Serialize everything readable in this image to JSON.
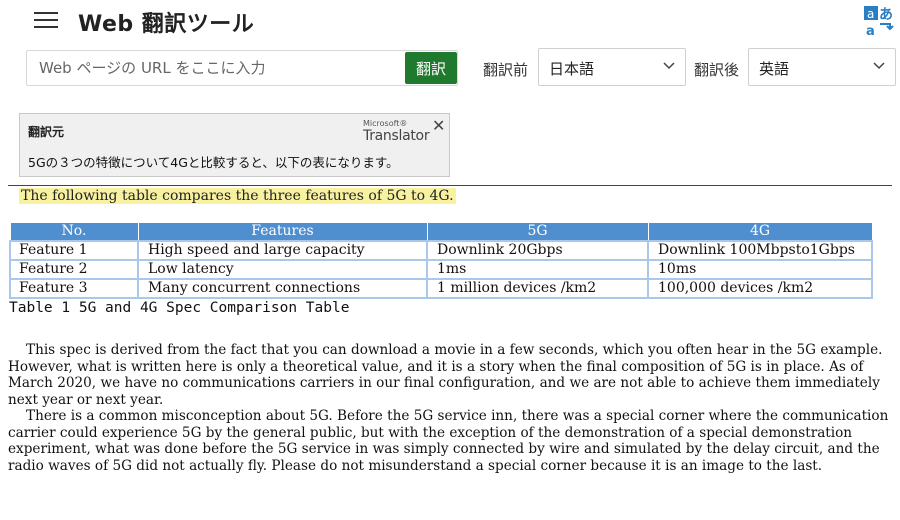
{
  "header": {
    "app_title": "Web 翻訳ツール"
  },
  "toolbar": {
    "url_placeholder": "Web ページの URL をここに入力",
    "translate_button": "翻訳",
    "source_label": "翻訳前",
    "source_value": "日本語",
    "target_label": "翻訳後",
    "target_value": "英語"
  },
  "popup": {
    "source_heading": "翻訳元",
    "provider_small": "Microsoft®",
    "provider_name": "Translator",
    "source_text": "5Gの３つの特徴について4Gと比較すると、以下の表になります。"
  },
  "content": {
    "translated_sentence": "The following table compares the three features of 5G to 4G.",
    "table": {
      "headers": [
        "No.",
        "Features",
        "5G",
        "4G"
      ],
      "rows": [
        [
          "Feature 1",
          "High speed and large capacity",
          "Downlink 20Gbps",
          "Downlink 100Mbpsto1Gbps"
        ],
        [
          "Feature 2",
          "Low latency",
          "1ms",
          "10ms"
        ],
        [
          "Feature 3",
          "Many concurrent connections",
          "1 million devices /km2",
          "100,000 devices /km2"
        ]
      ]
    },
    "caption": "Table 1 5G and 4G Spec Comparison Table",
    "paragraphs": [
      "This spec is derived from the fact that you can download a movie in a few seconds, which you often hear in the 5G example. However, what is written here is only a theoretical value, and it is a story when the final composition of 5G is in place. As of March 2020, we have no communications carriers in our final configuration, and we are not able to achieve them immediately next year or next year.",
      "There is a common misconception about 5G. Before the 5G service inn, there was a special corner where the communication carrier could experience 5G by the general public, but with the exception of the demonstration of a special demonstration experiment, what was done before the 5G service in was simply connected by wire and simulated by the delay circuit, and the radio waves of 5G did not actually fly. Please do not misunderstand a special corner because it is an image to the last."
    ]
  },
  "colors": {
    "header_blue": "#4f8fd0",
    "button_green": "#1f7a2e",
    "highlight_yellow": "#f7f1a0"
  },
  "icons": [
    "menu-icon",
    "translator-logo-icon",
    "chevron-down-icon",
    "close-icon"
  ]
}
